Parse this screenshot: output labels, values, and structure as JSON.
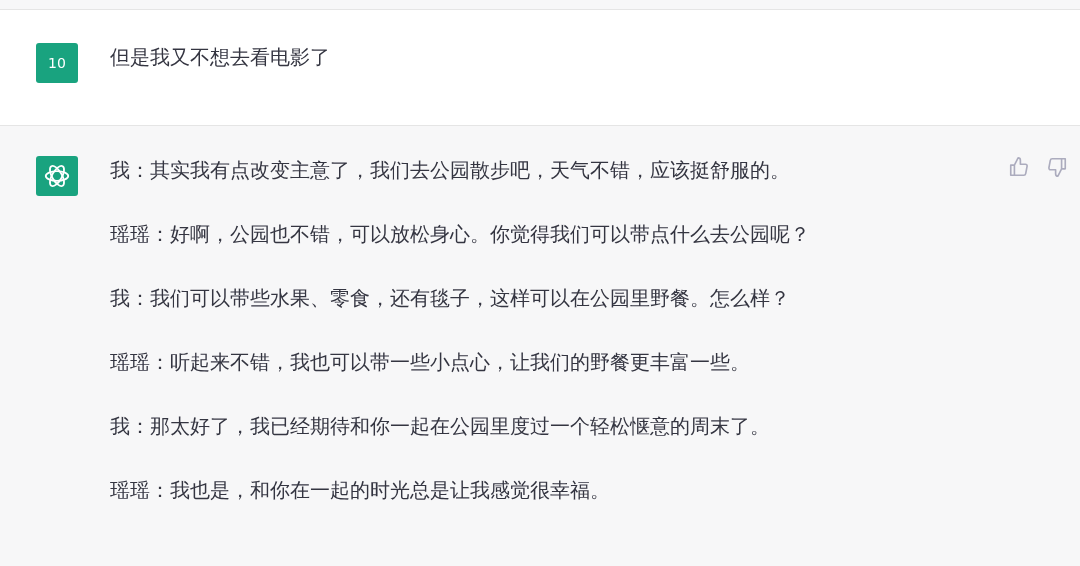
{
  "messages": [
    {
      "kind": "user",
      "avatar": "10",
      "paragraphs": [
        "但是我又不想去看电影了"
      ]
    },
    {
      "kind": "assistant",
      "paragraphs": [
        "我：其实我有点改变主意了，我们去公园散步吧，天气不错，应该挺舒服的。",
        "瑶瑶：好啊，公园也不错，可以放松身心。你觉得我们可以带点什么去公园呢？",
        "我：我们可以带些水果、零食，还有毯子，这样可以在公园里野餐。怎么样？",
        "瑶瑶：听起来不错，我也可以带一些小点心，让我们的野餐更丰富一些。",
        "我：那太好了，我已经期待和你一起在公园里度过一个轻松惬意的周末了。",
        "瑶瑶：我也是，和你在一起的时光总是让我感觉很幸福。"
      ]
    }
  ]
}
